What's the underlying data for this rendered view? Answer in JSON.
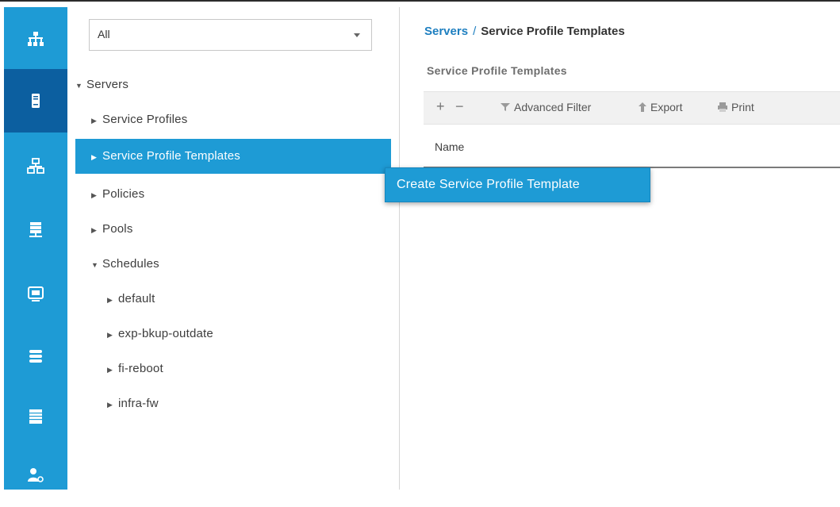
{
  "filter": {
    "value": "All"
  },
  "tree": {
    "servers": "Servers",
    "service_profiles": "Service Profiles",
    "service_profile_templates": "Service Profile Templates",
    "policies": "Policies",
    "pools": "Pools",
    "schedules": "Schedules",
    "schedule_items": [
      "default",
      "exp-bkup-outdate",
      "fi-reboot",
      "infra-fw"
    ]
  },
  "breadcrumb": {
    "root": "Servers",
    "separator": "/",
    "current": "Service Profile Templates"
  },
  "section_title": "Service Profile Templates",
  "toolbar": {
    "add": "+",
    "remove": "−",
    "advanced_filter": "Advanced Filter",
    "export": "Export",
    "print": "Print"
  },
  "table": {
    "columns": [
      "Name"
    ]
  },
  "context_menu": {
    "item": "Create Service Profile Template"
  },
  "rail_icons": [
    "network-icon",
    "server-icon",
    "lan-icon",
    "san-icon",
    "vm-icon",
    "storage-icon",
    "chassis-icon",
    "admin-icon"
  ],
  "colors": {
    "accent": "#1e9bd5",
    "rail_active": "#0c5fa0",
    "link": "#1e7fc0"
  }
}
